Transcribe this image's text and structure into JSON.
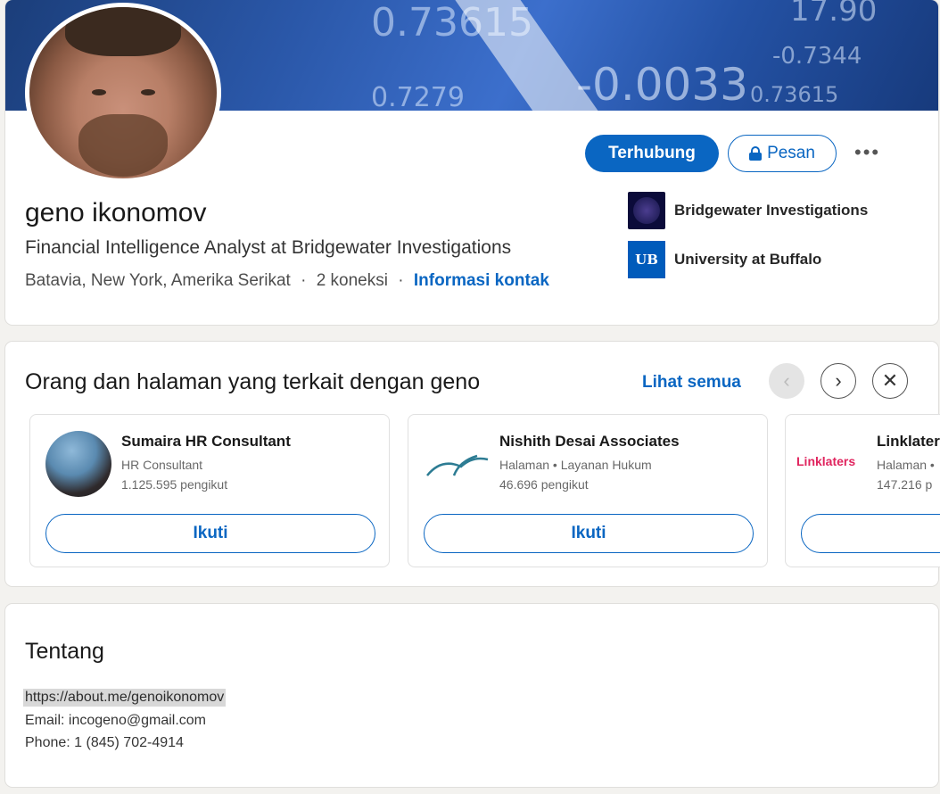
{
  "profile": {
    "name": "geno ikonomov",
    "headline": "Financial Intelligence Analyst at Bridgewater Investigations",
    "location": "Batavia, New York, Amerika Serikat",
    "separator": "·",
    "connections": "2 koneksi",
    "contact_info": "Informasi kontak",
    "banner_numbers": [
      "0.73615",
      "17.90",
      "-0.7344",
      "-0.0033",
      "0.73615",
      "0.7279"
    ]
  },
  "actions": {
    "connected": "Terhubung",
    "message": "Pesan",
    "more": "•••"
  },
  "affiliations": [
    {
      "name": "Bridgewater Investigations",
      "icon": "bridgewater-logo"
    },
    {
      "name": "University at Buffalo",
      "icon": "ub-logo",
      "logo_text": "UB"
    }
  ],
  "related": {
    "title": "Orang dan halaman yang terkait dengan geno",
    "see_all": "Lihat semua",
    "prev": "‹",
    "next": "›",
    "close": "✕",
    "cards": [
      {
        "title": "Sumaira HR Consultant",
        "subtitle": "HR Consultant",
        "followers": "1.125.595 pengikut",
        "button": "Ikuti"
      },
      {
        "title": "Nishith Desai Associates",
        "subtitle": "Halaman • Layanan Hukum",
        "followers": "46.696 pengikut",
        "button": "Ikuti"
      },
      {
        "title": "Linklaters",
        "logo_text": "Linklaters",
        "subtitle": "Halaman •",
        "followers": "147.216 p",
        "button": ""
      }
    ]
  },
  "about": {
    "title": "Tentang",
    "lines": [
      "https://about.me/genoikonomov",
      "Email: incogeno@gmail.com",
      "Phone: 1 (845) 702-4914"
    ]
  },
  "colors": {
    "accent": "#0a66c2",
    "background": "#f3f2ef"
  }
}
